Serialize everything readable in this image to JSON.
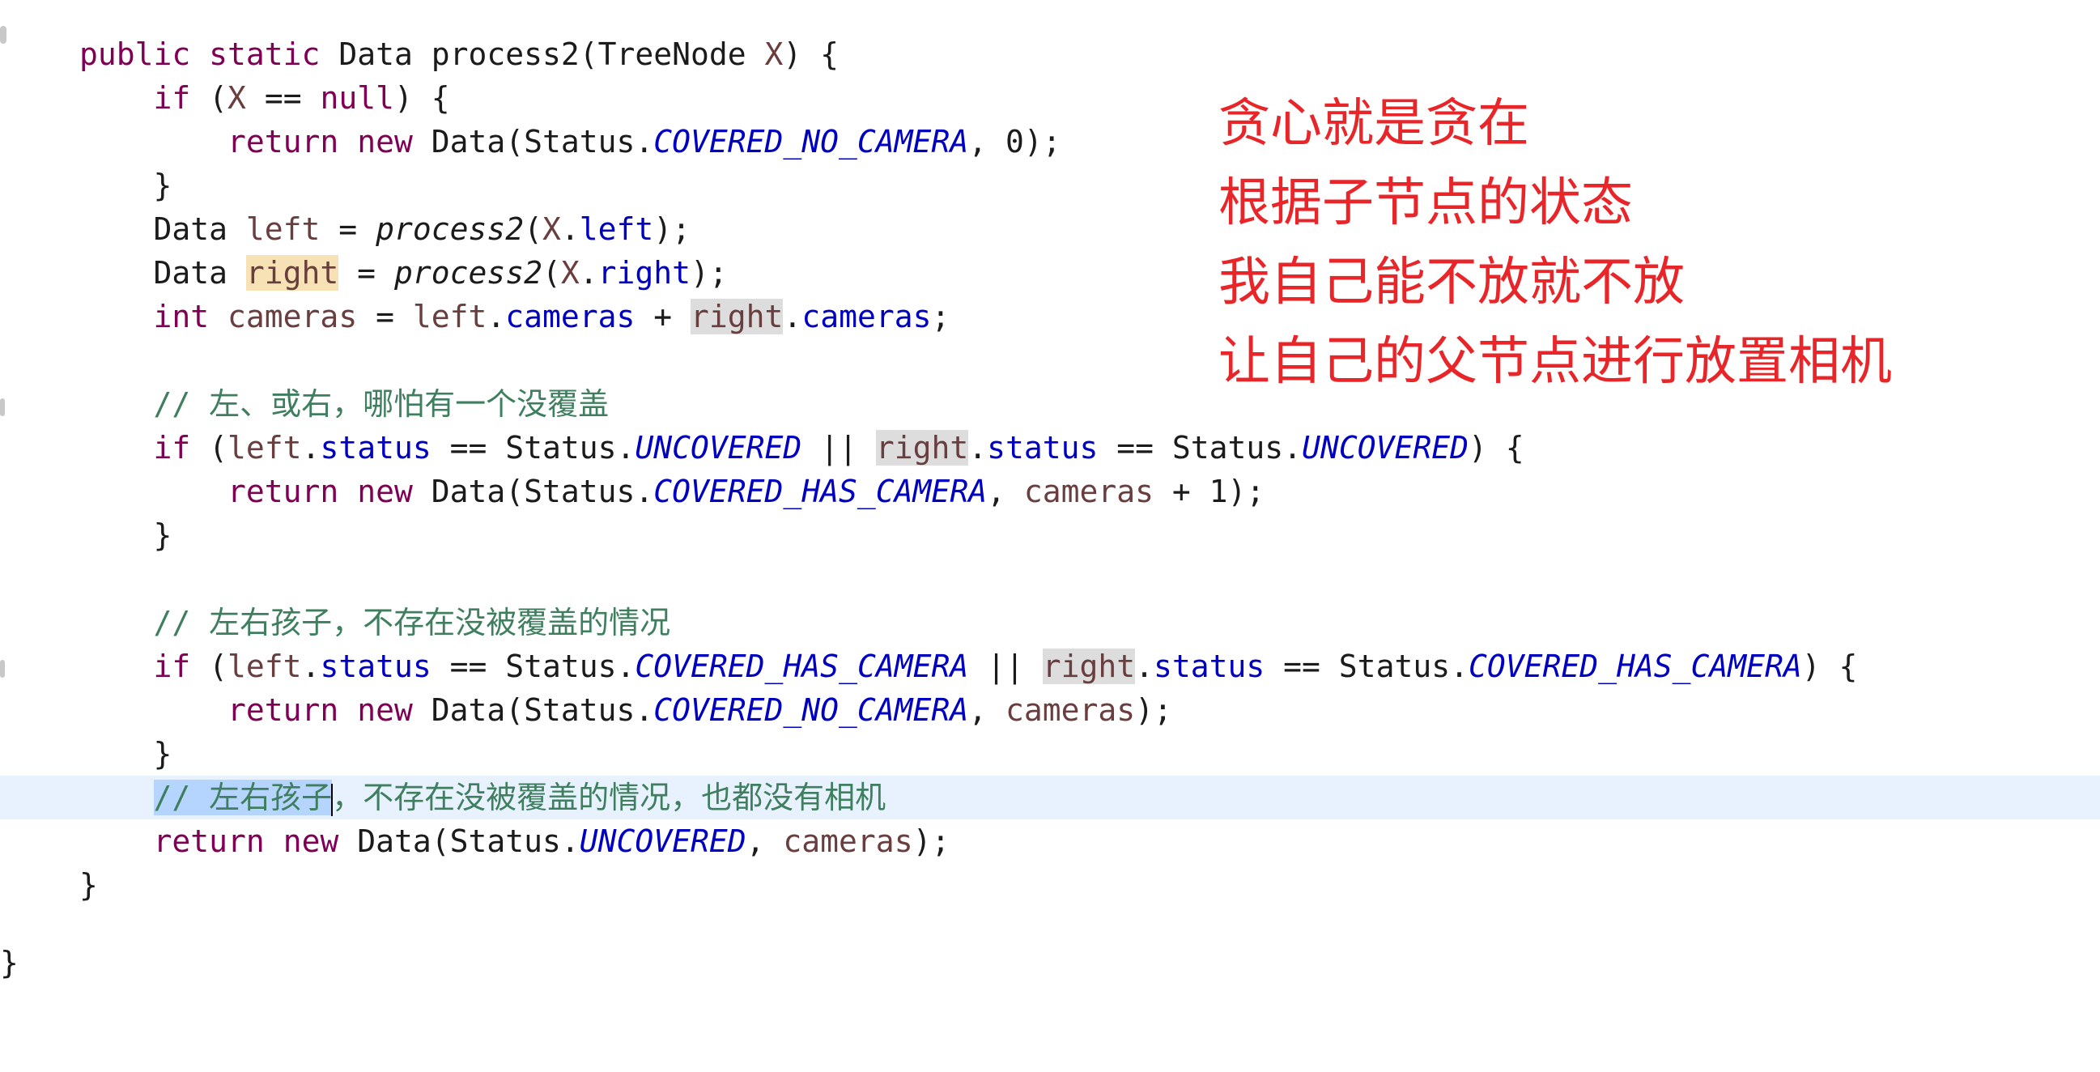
{
  "code_lines": [
    "public static Data process2(TreeNode X) {",
    "    if (X == null) {",
    "        return new Data(Status.COVERED_NO_CAMERA, 0);",
    "    }",
    "    Data left = process2(X.left);",
    "    Data right = process2(X.right);",
    "    int cameras = left.cameras + right.cameras;",
    "",
    "    // 左、或右，哪怕有一个没覆盖",
    "    if (left.status == Status.UNCOVERED || right.status == Status.UNCOVERED) {",
    "        return new Data(Status.COVERED_HAS_CAMERA, cameras + 1);",
    "    }",
    "",
    "    // 左右孩子，不存在没被覆盖的情况",
    "    if (left.status == Status.COVERED_HAS_CAMERA || right.status == Status.COVERED_HAS_CAMERA) {",
    "        return new Data(Status.COVERED_NO_CAMERA, cameras);",
    "    }",
    "    // 左右孩子，不存在没被覆盖的情况，也都没有相机",
    "    return new Data(Status.UNCOVERED, cameras);",
    "}",
    "",
    "}"
  ],
  "annotation": {
    "lines": [
      "贪心就是贪在",
      "根据子节点的状态",
      "我自己能不放就不放",
      "让自己的父节点进行放置相机"
    ],
    "color": "#e8262a"
  },
  "colors": {
    "keyword": "#7f0055",
    "field": "#0000c0",
    "comment": "#3f7f5f",
    "current_line": "#e8f2fe",
    "write_highlight": "#f6e2b5",
    "read_highlight": "#dddddd"
  }
}
